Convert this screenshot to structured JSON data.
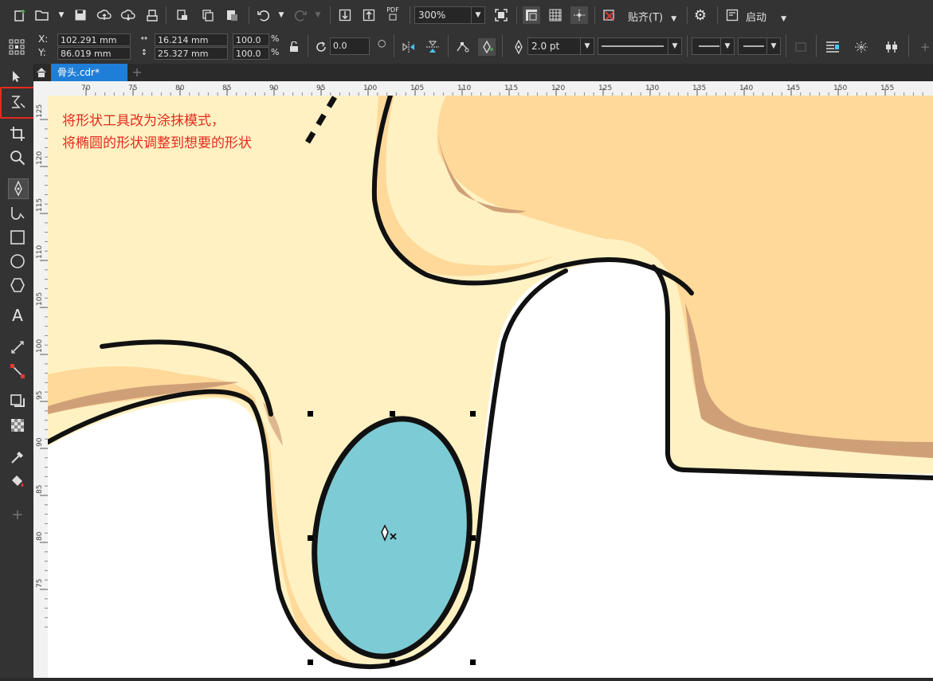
{
  "toolbar": {
    "pdf_label": "PDF",
    "zoom": "300%",
    "snap_label": "贴齐(T)",
    "launch_label": "启动"
  },
  "property_bar": {
    "x_label": "X:",
    "y_label": "Y:",
    "x_value": "102.291 mm",
    "y_value": "86.019 mm",
    "width_value": "16.214 mm",
    "height_value": "25.327 mm",
    "scale_x": "100.0",
    "scale_y": "100.0",
    "percent": "%",
    "rotation": "0.0",
    "outline_width": "2.0 pt"
  },
  "tab": {
    "doc_name": "骨头.cdr*"
  },
  "ruler": {
    "h_ticks": [
      "70",
      "75",
      "80",
      "85",
      "90",
      "95",
      "100",
      "105",
      "110",
      "115",
      "120",
      "125",
      "130",
      "135",
      "140",
      "145",
      "150",
      "155"
    ],
    "v_ticks": [
      "125",
      "120",
      "115",
      "110",
      "105",
      "100",
      "95",
      "90",
      "85",
      "80",
      "75"
    ]
  },
  "annotation": {
    "line1": "将形状工具改为涂抹模式，",
    "line2": "将椭圆的形状调整到想要的形状"
  },
  "colors": {
    "cream": "#fff1c2",
    "tan": "#fed99a",
    "brown": "#cfa078",
    "ellipse_fill": "#7dcbd4",
    "highlight": "#e62b1e"
  },
  "icons": {
    "active_tool": "smear-shape-tool-icon"
  }
}
